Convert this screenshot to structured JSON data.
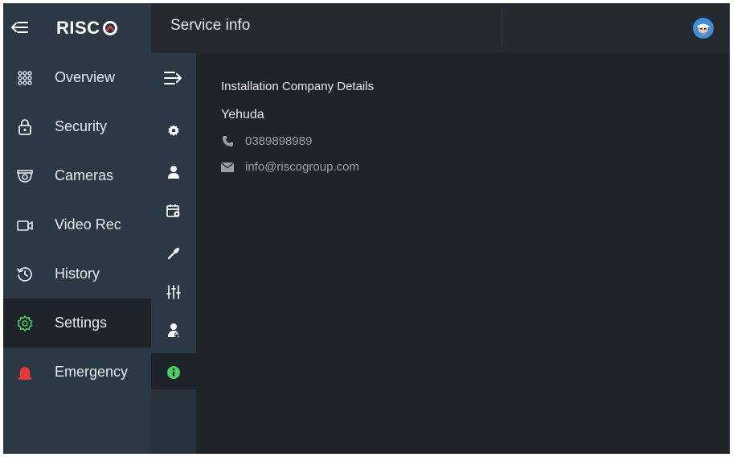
{
  "header": {
    "brand": "RISC",
    "title": "Service info"
  },
  "sidebar": {
    "items": [
      {
        "label": "Overview",
        "icon": "grid-dots-icon"
      },
      {
        "label": "Security",
        "icon": "lock-icon"
      },
      {
        "label": "Cameras",
        "icon": "camera-icon"
      },
      {
        "label": "Video Rec",
        "icon": "video-icon"
      },
      {
        "label": "History",
        "icon": "history-icon"
      },
      {
        "label": "Settings",
        "icon": "gear-icon",
        "active": true
      },
      {
        "label": "Emergency",
        "icon": "siren-icon"
      }
    ]
  },
  "subnav": {
    "icons": [
      "expand-icon",
      "gear-icon",
      "user-icon",
      "calendar-icon",
      "wrench-icon",
      "sliders-icon",
      "users-icon",
      "info-icon"
    ],
    "active": "info-icon"
  },
  "main": {
    "section_heading": "Installation Company Details",
    "company_name": "Yehuda",
    "phone": "0389898989",
    "email": "info@riscogroup.com"
  },
  "colors": {
    "sidebar_bg": "#2b3947",
    "content_bg": "#1f232a",
    "active_icon": "#46d160",
    "emergency": "#e53935"
  }
}
